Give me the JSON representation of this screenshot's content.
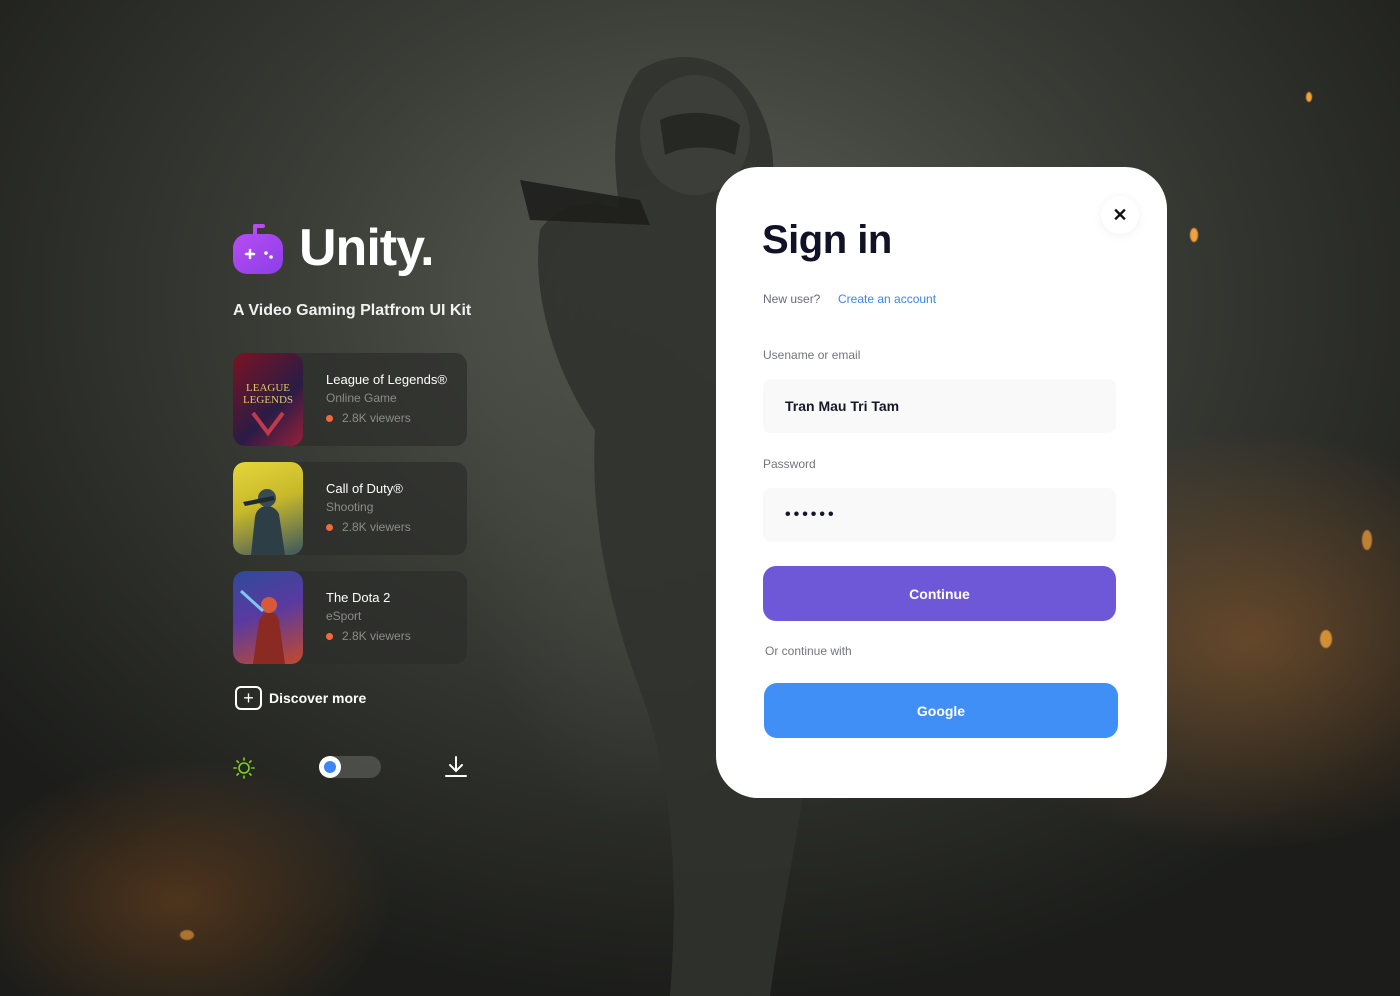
{
  "brand": {
    "title": "Unity.",
    "subtitle": "A Video Gaming Platfrom UI Kit",
    "accent": "#a24bf2"
  },
  "games": [
    {
      "title": "League of Legends®",
      "genre": "Online Game",
      "viewers": "2.8K viewers",
      "thumb_colors": [
        "#7c1222",
        "#2a1c45"
      ]
    },
    {
      "title": "Call of Duty®",
      "genre": "Shooting",
      "viewers": "2.8K viewers",
      "thumb_colors": [
        "#d6c834",
        "#3b5560"
      ]
    },
    {
      "title": "The Dota 2",
      "genre": "eSport",
      "viewers": "2.8K viewers",
      "thumb_colors": [
        "#3c4a9a",
        "#c24a2a"
      ]
    }
  ],
  "discover_label": "Discover more",
  "controls": {
    "theme_icon": "sun-icon",
    "download_icon": "download-icon"
  },
  "signin": {
    "title": "Sign in",
    "close_icon": "close-icon",
    "new_user_text": "New user?",
    "create_account_link": "Create an account",
    "username_label": "Usename or email",
    "username_value": "Tran Mau Tri Tam",
    "password_label": "Password",
    "password_value": "••••••",
    "continue_label": "Continue",
    "or_text": "Or continue with",
    "google_label": "Google",
    "primary_color": "#6f58d8",
    "google_color": "#3f8ff6",
    "link_color": "#3a85f2"
  }
}
